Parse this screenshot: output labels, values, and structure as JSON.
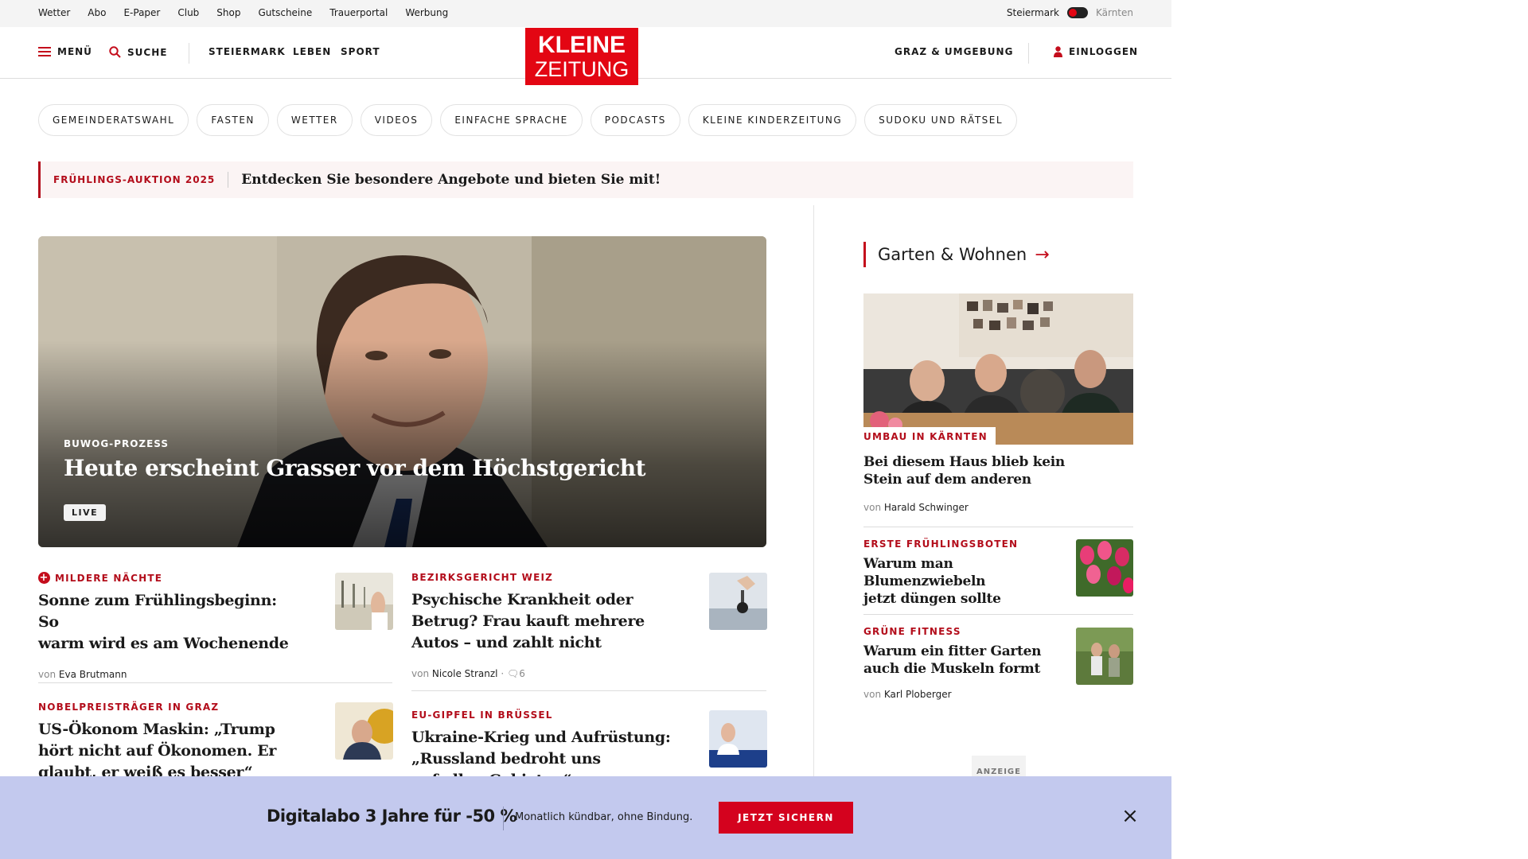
{
  "topbar": {
    "links": [
      "Wetter",
      "Abo",
      "E-Paper",
      "Club",
      "Shop",
      "Gutscheine",
      "Trauerportal",
      "Werbung"
    ],
    "region_left": "Steiermark",
    "region_right": "Kärnten"
  },
  "header": {
    "menu_label": "MENÜ",
    "search_label": "SUCHE",
    "nav": [
      "STEIERMARK",
      "LEBEN",
      "SPORT"
    ],
    "logo_line1": "KLEINE",
    "logo_line2": "ZEITUNG",
    "location_label": "GRAZ & UMGEBUNG",
    "login_label": "EINLOGGEN"
  },
  "chips": [
    "GEMEINDERATSWAHL",
    "FASTEN",
    "WETTER",
    "VIDEOS",
    "EINFACHE SPRACHE",
    "PODCASTS",
    "KLEINE KINDERZEITUNG",
    "SUDOKU UND RÄTSEL"
  ],
  "promo": {
    "tag": "FRÜHLINGS-AUKTION 2025",
    "message": "Entdecken Sie besondere Angebote und bieten Sie mit!"
  },
  "hero": {
    "kicker": "BUWOG-PROZESS",
    "title": "Heute erscheint Grasser vor dem Höchstgericht",
    "badge": "LIVE"
  },
  "articles": [
    {
      "kicker": "MILDERE NÄCHTE",
      "title_lines": [
        "Sonne zum Frühlingsbeginn: So",
        "warm wird es am Wochenende"
      ],
      "by_prefix": "von",
      "author": "Eva Brutmann"
    },
    {
      "kicker": "BEZIRKSGERICHT WEIZ",
      "title_lines": [
        "Psychische Krankheit oder",
        "Betrug? Frau kauft mehrere",
        "Autos – und zahlt nicht"
      ],
      "by_prefix": "von",
      "author": "Nicole Stranzl",
      "comments": "6"
    },
    {
      "kicker": "NOBELPREISTRÄGER IN GRAZ",
      "title_lines": [
        "US-Ökonom Maskin: „Trump",
        "hört nicht auf Ökonomen. Er",
        "glaubt, er weiß es besser“"
      ]
    },
    {
      "kicker": "EU-GIPFEL IN BRÜSSEL",
      "title_lines": [
        "Ukraine-Krieg und Aufrüstung:",
        "„Russland bedroht uns",
        "auf allen Gebieten“"
      ]
    }
  ],
  "sidebar": {
    "section_title": "Garten & Wohnen",
    "lead": {
      "kicker": "UMBAU IN KÄRNTEN",
      "title_lines": [
        "Bei diesem Haus blieb kein",
        "Stein auf dem anderen"
      ],
      "by_prefix": "von",
      "author": "Harald Schwinger"
    },
    "items": [
      {
        "kicker": "ERSTE FRÜHLINGSBOTEN",
        "title_lines": [
          "Warum man Blumenzwiebeln",
          "jetzt düngen sollte"
        ]
      },
      {
        "kicker": "GRÜNE FITNESS",
        "title_lines": [
          "Warum ein fitter Garten",
          "auch die Muskeln formt"
        ],
        "by_prefix": "von",
        "author": "Karl Ploberger"
      }
    ],
    "ad_label": "ANZEIGE"
  },
  "subscription": {
    "headline": "Digitalabo 3 Jahre für -50 %",
    "note": "Monatlich kündbar, ohne Bindung.",
    "cta": "JETZT SICHERN",
    "close": "×"
  },
  "colors": {
    "brand_red": "#e30613",
    "kicker_red": "#b30d1b",
    "subbar_bg": "#c3c9ee"
  }
}
